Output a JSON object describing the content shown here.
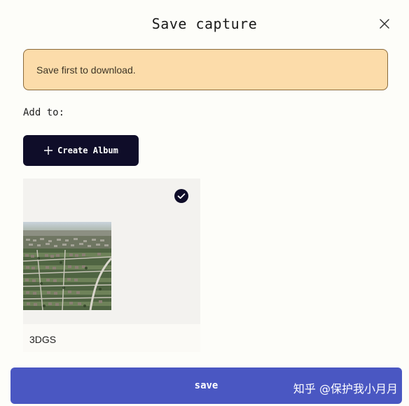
{
  "dialog": {
    "title": "Save capture",
    "close_icon": "close-icon"
  },
  "alert": {
    "message": "Save first to download."
  },
  "add_to": {
    "label": "Add to:"
  },
  "create_album": {
    "icon": "plus-icon",
    "label": "Create Album"
  },
  "albums": [
    {
      "name": "3DGS",
      "selected": true,
      "selected_icon": "checkmark-circle-icon",
      "thumbnail": "aerial suburban neighborhood photo"
    }
  ],
  "save_button": {
    "label": "save"
  },
  "watermark": {
    "text": "知乎 @保护我小月月"
  },
  "colors": {
    "alert_bg": "#fcdcaa",
    "create_button_bg": "#0f0d29",
    "save_button_bg": "#4a57c2"
  }
}
